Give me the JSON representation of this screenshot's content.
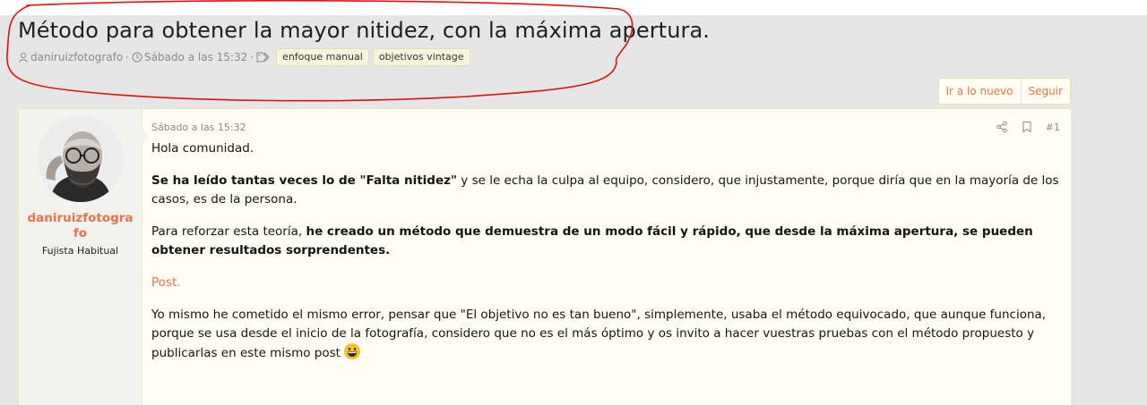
{
  "thread": {
    "title": "Método para obtener la mayor nitidez, con la máxima apertura.",
    "author": "daniruizfotografo",
    "date": "Sábado a las 15:32",
    "separator": "·",
    "tags": [
      "enfoque manual",
      "objetivos vintage"
    ]
  },
  "actions": {
    "new_label": "Ir a lo nuevo",
    "follow_label": "Seguir"
  },
  "post": {
    "date": "Sábado a las 15:32",
    "number": "#1",
    "user": {
      "name": "daniruizfotografo",
      "title": "Fujista Habitual"
    },
    "greeting": "Hola comunidad.",
    "p2_bold": "Se ha leído tantas veces lo de \"Falta nitidez\"",
    "p2_rest": " y se le echa la culpa al equipo, considero, que injustamente, porque diría que en la mayoría de los casos, es de la persona.",
    "p3_start": "Para reforzar esta teoría, ",
    "p3_bold": "he creado un método que demuestra de un modo fácil y rápido, que desde la máxima apertura, se pueden obtener resultados sorprendentes.",
    "link_text": "Post.",
    "p5": "Yo mismo he cometido el mismo error, pensar que \"El objetivo no es tan bueno\", simplemente, usaba el método equivocado, que aunque funciona, porque se usa desde el inicio de la fotografía, considero que no es el más óptimo y os invito a hacer vuestras pruebas con el método propuesto y publicarlas en este mismo post"
  },
  "icons": {
    "author": "user-icon",
    "date": "clock-icon",
    "tags": "tags-icon",
    "share": "share-icon",
    "bookmark": "bookmark-icon",
    "emoji": "grinning-emoji-icon"
  },
  "colors": {
    "accent": "#e8734a",
    "annotation": "#e01010",
    "post_bg": "#fffef4",
    "tag_bg": "#f7f5dc"
  }
}
